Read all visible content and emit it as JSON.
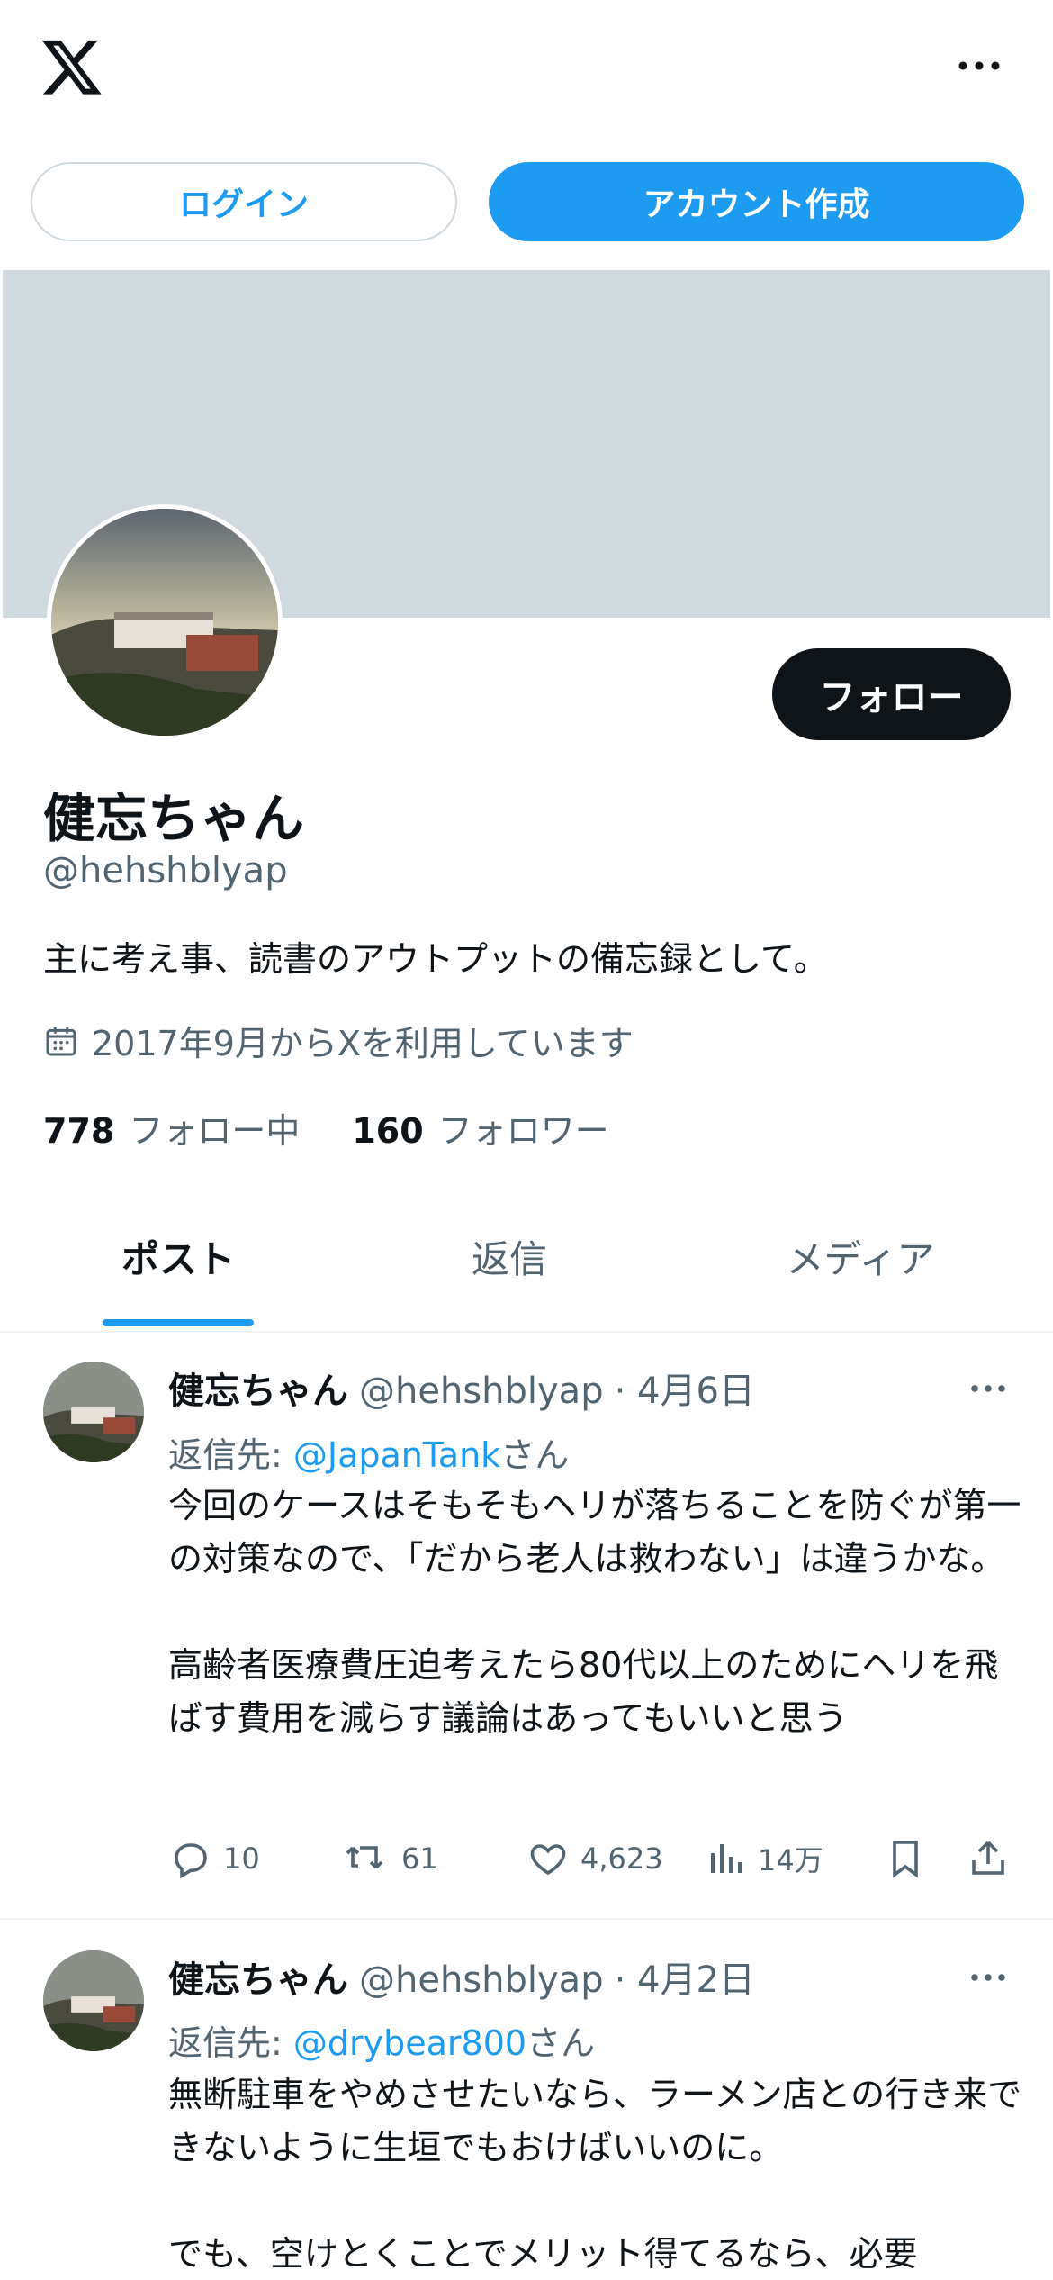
{
  "topbar": {
    "login_label": "ログイン",
    "signup_label": "アカウント作成"
  },
  "profile": {
    "name": "健忘ちゃん",
    "handle": "@hehshblyap",
    "bio": "主に考え事、読書のアウトプットの備忘録として。",
    "joined": "2017年9月からXを利用しています",
    "following_count": "778",
    "following_label": "フォロー中",
    "followers_count": "160",
    "followers_label": "フォロワー",
    "follow_label": "フォロー"
  },
  "tabs": [
    {
      "label": "ポスト",
      "active": true
    },
    {
      "label": "返信",
      "active": false
    },
    {
      "label": "メディア",
      "active": false
    }
  ],
  "posts": [
    {
      "name": "健忘ちゃん",
      "handle": "@hehshblyap",
      "date": "· 4月6日",
      "reply_prefix": "返信先: ",
      "reply_mention": "@JapanTank",
      "reply_suffix": "さん",
      "body": "今回のケースはそもそもヘリが落ちることを防ぐが第一の対策なので、「だから老人は救わない」は違うかな。\n\n高齢者医療費圧迫考えたら80代以上のためにヘリを飛ばす費用を減らす議論はあってもいいと思う",
      "replies": "10",
      "reposts": "61",
      "likes": "4,623",
      "views": "14万"
    },
    {
      "name": "健忘ちゃん",
      "handle": "@hehshblyap",
      "date": "· 4月2日",
      "reply_prefix": "返信先: ",
      "reply_mention": "@drybear800",
      "reply_suffix": "さん",
      "body": "無断駐車をやめさせたいなら、ラーメン店との行き来できないように生垣でもおけばいいのに。\n\nでも、空けとくことでメリット得てるなら、必要"
    }
  ],
  "colors": {
    "accent": "#1d9bf0",
    "text": "#0f1419",
    "muted": "#536471",
    "banner": "#cfd9de"
  }
}
